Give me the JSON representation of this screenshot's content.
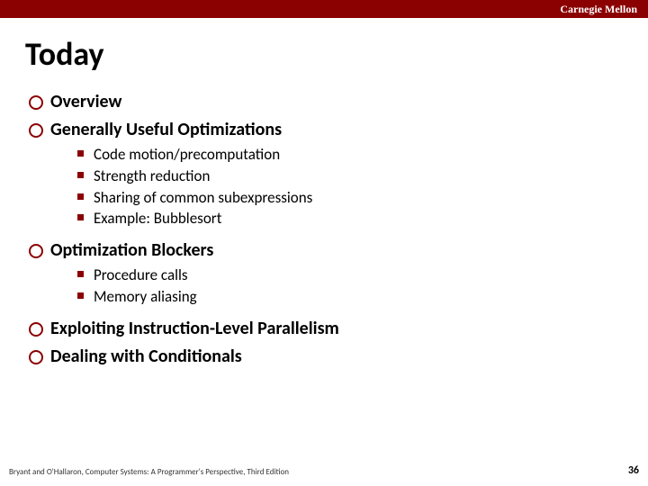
{
  "brand": "Carnegie Mellon",
  "title": "Today",
  "items": [
    {
      "label": "Overview"
    },
    {
      "label": "Generally Useful Optimizations",
      "sub": [
        "Code motion/precomputation",
        "Strength reduction",
        "Sharing of common subexpressions",
        "Example: Bubblesort"
      ]
    },
    {
      "label": "Optimization Blockers",
      "sub": [
        "Procedure calls",
        "Memory aliasing"
      ]
    },
    {
      "label": "Exploiting Instruction-Level Parallelism"
    },
    {
      "label": "Dealing with Conditionals"
    }
  ],
  "footer": "Bryant and O'Hallaron, Computer Systems: A Programmer's Perspective, Third Edition",
  "page": "36"
}
